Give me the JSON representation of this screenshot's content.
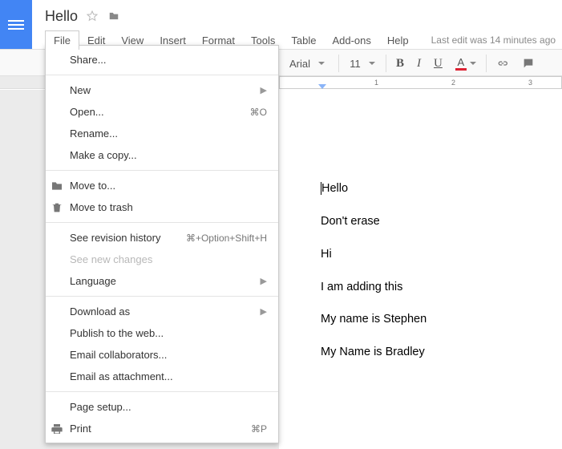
{
  "app": {
    "doc_title": "Hello",
    "last_edit": "Last edit was 14 minutes ago"
  },
  "menus": {
    "file": "File",
    "edit": "Edit",
    "view": "View",
    "insert": "Insert",
    "format": "Format",
    "tools": "Tools",
    "table": "Table",
    "addons": "Add-ons",
    "help": "Help"
  },
  "toolbar": {
    "font": "Arial",
    "size": "11",
    "bold": "B",
    "italic": "I",
    "underline": "U",
    "textcolor": "A"
  },
  "ruler": {
    "n1": "1",
    "n2": "2",
    "n3": "3"
  },
  "file_menu": {
    "share": "Share...",
    "new": "New",
    "open": "Open...",
    "open_sc": "⌘O",
    "rename": "Rename...",
    "copy": "Make a copy...",
    "move": "Move to...",
    "trash": "Move to trash",
    "history": "See revision history",
    "history_sc": "⌘+Option+Shift+H",
    "changes": "See new changes",
    "language": "Language",
    "download": "Download as",
    "publish": "Publish to the web...",
    "email_collab": "Email collaborators...",
    "email_attach": "Email as attachment...",
    "page_setup": "Page setup...",
    "print": "Print",
    "print_sc": "⌘P"
  },
  "doc": {
    "l1": "Hello",
    "l2": "Don't erase",
    "l3": "Hi",
    "l4": "I am adding this",
    "l5": "My name is Stephen",
    "l6": "My Name is Bradley"
  }
}
